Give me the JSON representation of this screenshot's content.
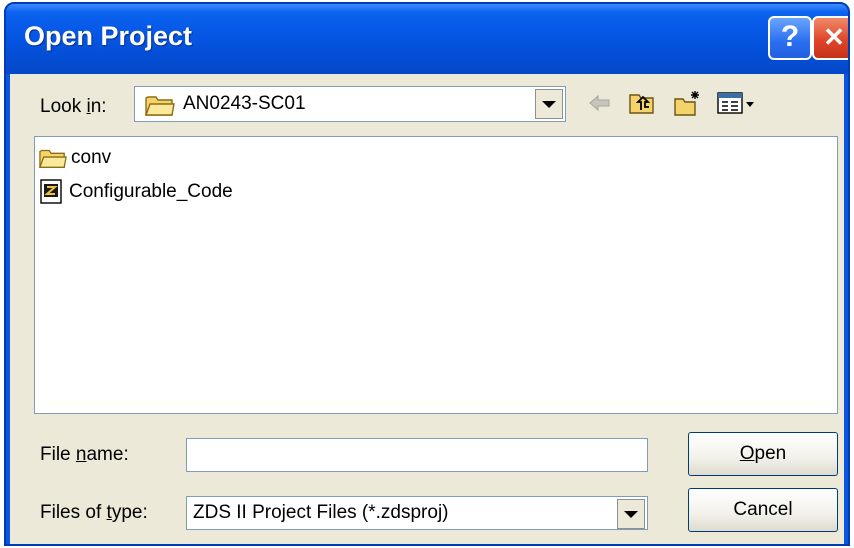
{
  "window": {
    "title": "Open Project"
  },
  "title_buttons": {
    "help": "?",
    "close": "✕"
  },
  "look_in": {
    "label_pre": "Look ",
    "label_key": "i",
    "label_post": "n:",
    "value": "AN0243-SC01"
  },
  "toolbar_icons": [
    "back-arrow-icon",
    "up-folder-icon",
    "new-folder-icon",
    "view-menu-icon"
  ],
  "files": [
    {
      "name": "conv",
      "icon": "folder-icon"
    },
    {
      "name": "Configurable_Code",
      "icon": "zds-project-file-icon"
    }
  ],
  "file_name": {
    "label_pre": "File ",
    "label_key": "n",
    "label_post": "ame:",
    "value": ""
  },
  "file_type": {
    "label_pre": "Files of ",
    "label_key": "t",
    "label_post": "ype:",
    "value": "ZDS II Project Files (*.zdsproj)"
  },
  "buttons": {
    "open_key": "O",
    "open_rest": "pen",
    "cancel": "Cancel"
  },
  "colors": {
    "titlebar": "#0553e0",
    "dialog_bg": "#ece9d8",
    "input_border": "#7f9db9"
  }
}
